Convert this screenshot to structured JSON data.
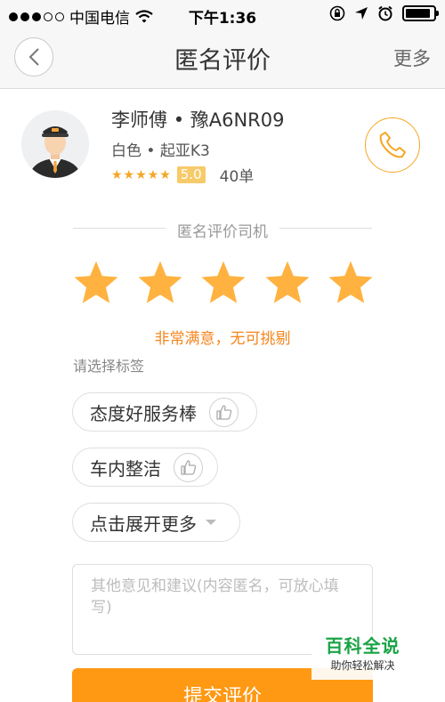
{
  "status_bar": {
    "carrier": "中国电信",
    "time": "下午1:36",
    "battery_level": 0.9
  },
  "nav": {
    "title": "匿名评价",
    "more_label": "更多"
  },
  "driver": {
    "name": "李师傅",
    "plate": "豫A6NR09",
    "color": "白色",
    "car_model": "起亚K3",
    "stars": "★★★★★",
    "score": "5.0",
    "orders": "40单"
  },
  "rating": {
    "section_label": "匿名评价司机",
    "star_count": 5,
    "selected_stars": 5,
    "star_color": "#ffb23f",
    "result_text": "非常满意，无可挑剔"
  },
  "tags": {
    "prompt": "请选择标签",
    "items": [
      {
        "label": "态度好服务棒"
      },
      {
        "label": "车内整洁"
      }
    ],
    "expand_label": "点击展开更多"
  },
  "comment": {
    "placeholder": "其他意见和建议(内容匿名，可放心填写)"
  },
  "submit": {
    "label": "提交评价"
  },
  "watermark": {
    "title": "百科全说",
    "subtitle": "助你轻松解决"
  },
  "colors": {
    "accent": "#ff9812",
    "star": "#ffb23f",
    "text_orange": "#f5861f"
  }
}
